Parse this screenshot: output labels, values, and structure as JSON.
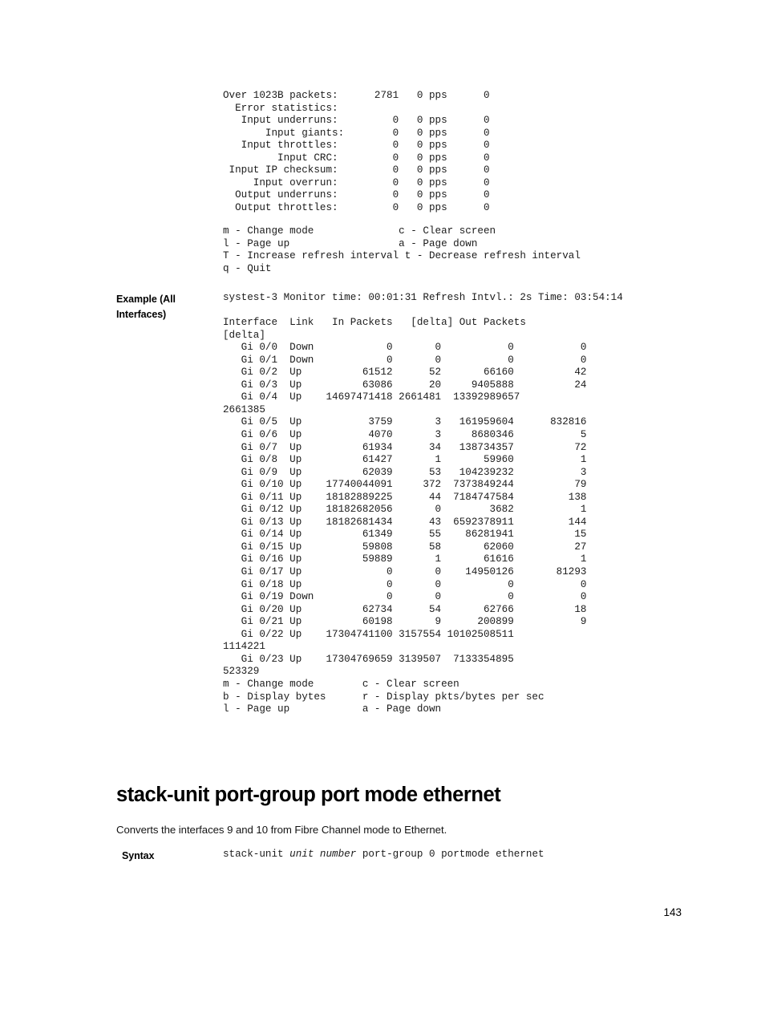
{
  "page": {
    "number": "143"
  },
  "console_stats": {
    "lines": [
      "Over 1023B packets:      2781   0 pps      0",
      "  Error statistics:",
      "   Input underruns:         0   0 pps      0",
      "       Input giants:        0   0 pps      0",
      "   Input throttles:         0   0 pps      0",
      "         Input CRC:         0   0 pps      0",
      " Input IP checksum:         0   0 pps      0",
      "     Input overrun:         0   0 pps      0",
      "  Output underruns:         0   0 pps      0",
      "  Output throttles:         0   0 pps      0"
    ]
  },
  "console_menu_first": {
    "lines": [
      "m - Change mode              c - Clear screen",
      "l - Page up                  a - Page down",
      "T - Increase refresh interval t - Decrease refresh interval",
      "q - Quit"
    ]
  },
  "example_section": {
    "label": "Example (All Interfaces)",
    "header_line": "systest-3 Monitor time: 00:01:31 Refresh Intvl.: 2s Time: 03:54:14",
    "table_header": "Interface  Link   In Packets   [delta] Out Packets [delta]",
    "columns": [
      "Interface",
      "Link",
      "In Packets",
      "[delta]",
      "Out Packets",
      "[delta]"
    ],
    "rows": [
      {
        "interface": "Gi 0/0",
        "link": "Down",
        "in_packets": "0",
        "in_delta": "0",
        "out_packets": "0",
        "out_delta": "0"
      },
      {
        "interface": "Gi 0/1",
        "link": "Down",
        "in_packets": "0",
        "in_delta": "0",
        "out_packets": "0",
        "out_delta": "0"
      },
      {
        "interface": "Gi 0/2",
        "link": "Up",
        "in_packets": "61512",
        "in_delta": "52",
        "out_packets": "66160",
        "out_delta": "42"
      },
      {
        "interface": "Gi 0/3",
        "link": "Up",
        "in_packets": "63086",
        "in_delta": "20",
        "out_packets": "9405888",
        "out_delta": "24"
      },
      {
        "interface": "Gi 0/4",
        "link": "Up",
        "in_packets": "14697471418",
        "in_delta": "2661481",
        "out_packets": "13392989657",
        "out_delta": "2661385"
      },
      {
        "interface": "Gi 0/5",
        "link": "Up",
        "in_packets": "3759",
        "in_delta": "3",
        "out_packets": "161959604",
        "out_delta": "832816"
      },
      {
        "interface": "Gi 0/6",
        "link": "Up",
        "in_packets": "4070",
        "in_delta": "3",
        "out_packets": "8680346",
        "out_delta": "5"
      },
      {
        "interface": "Gi 0/7",
        "link": "Up",
        "in_packets": "61934",
        "in_delta": "34",
        "out_packets": "138734357",
        "out_delta": "72"
      },
      {
        "interface": "Gi 0/8",
        "link": "Up",
        "in_packets": "61427",
        "in_delta": "1",
        "out_packets": "59960",
        "out_delta": "1"
      },
      {
        "interface": "Gi 0/9",
        "link": "Up",
        "in_packets": "62039",
        "in_delta": "53",
        "out_packets": "104239232",
        "out_delta": "3"
      },
      {
        "interface": "Gi 0/10",
        "link": "Up",
        "in_packets": "17740044091",
        "in_delta": "372",
        "out_packets": "7373849244",
        "out_delta": "79"
      },
      {
        "interface": "Gi 0/11",
        "link": "Up",
        "in_packets": "18182889225",
        "in_delta": "44",
        "out_packets": "7184747584",
        "out_delta": "138"
      },
      {
        "interface": "Gi 0/12",
        "link": "Up",
        "in_packets": "18182682056",
        "in_delta": "0",
        "out_packets": "3682",
        "out_delta": "1"
      },
      {
        "interface": "Gi 0/13",
        "link": "Up",
        "in_packets": "18182681434",
        "in_delta": "43",
        "out_packets": "6592378911",
        "out_delta": "144"
      },
      {
        "interface": "Gi 0/14",
        "link": "Up",
        "in_packets": "61349",
        "in_delta": "55",
        "out_packets": "86281941",
        "out_delta": "15"
      },
      {
        "interface": "Gi 0/15",
        "link": "Up",
        "in_packets": "59808",
        "in_delta": "58",
        "out_packets": "62060",
        "out_delta": "27"
      },
      {
        "interface": "Gi 0/16",
        "link": "Up",
        "in_packets": "59889",
        "in_delta": "1",
        "out_packets": "61616",
        "out_delta": "1"
      },
      {
        "interface": "Gi 0/17",
        "link": "Up",
        "in_packets": "0",
        "in_delta": "0",
        "out_packets": "14950126",
        "out_delta": "81293"
      },
      {
        "interface": "Gi 0/18",
        "link": "Up",
        "in_packets": "0",
        "in_delta": "0",
        "out_packets": "0",
        "out_delta": "0"
      },
      {
        "interface": "Gi 0/19",
        "link": "Down",
        "in_packets": "0",
        "in_delta": "0",
        "out_packets": "0",
        "out_delta": "0"
      },
      {
        "interface": "Gi 0/20",
        "link": "Up",
        "in_packets": "62734",
        "in_delta": "54",
        "out_packets": "62766",
        "out_delta": "18"
      },
      {
        "interface": "Gi 0/21",
        "link": "Up",
        "in_packets": "60198",
        "in_delta": "9",
        "out_packets": "200899",
        "out_delta": "9"
      },
      {
        "interface": "Gi 0/22",
        "link": "Up",
        "in_packets": "17304741100",
        "in_delta": "3157554",
        "out_packets": "10102508511",
        "out_delta": "1114221"
      },
      {
        "interface": "Gi 0/23",
        "link": "Up",
        "in_packets": "17304769659",
        "in_delta": "3139507",
        "out_packets": "7133354895",
        "out_delta": "523329"
      }
    ],
    "rendered_lines": [
      "Interface  Link   In Packets   [delta] Out Packets",
      "[delta]",
      "   Gi 0/0  Down            0       0           0           0",
      "   Gi 0/1  Down            0       0           0           0",
      "   Gi 0/2  Up          61512      52       66160          42",
      "   Gi 0/3  Up          63086      20     9405888          24",
      "   Gi 0/4  Up    14697471418 2661481  13392989657",
      "2661385",
      "   Gi 0/5  Up           3759       3   161959604      832816",
      "   Gi 0/6  Up           4070       3     8680346           5",
      "   Gi 0/7  Up          61934      34   138734357          72",
      "   Gi 0/8  Up          61427       1       59960           1",
      "   Gi 0/9  Up          62039      53   104239232           3",
      "   Gi 0/10 Up    17740044091     372  7373849244          79",
      "   Gi 0/11 Up    18182889225      44  7184747584         138",
      "   Gi 0/12 Up    18182682056       0        3682           1",
      "   Gi 0/13 Up    18182681434      43  6592378911         144",
      "   Gi 0/14 Up          61349      55    86281941          15",
      "   Gi 0/15 Up          59808      58       62060          27",
      "   Gi 0/16 Up          59889       1       61616           1",
      "   Gi 0/17 Up              0       0    14950126       81293",
      "   Gi 0/18 Up              0       0           0           0",
      "   Gi 0/19 Down            0       0           0           0",
      "   Gi 0/20 Up          62734      54       62766          18",
      "   Gi 0/21 Up          60198       9      200899           9",
      "   Gi 0/22 Up    17304741100 3157554 10102508511",
      "1114221",
      "   Gi 0/23 Up    17304769659 3139507  7133354895",
      "523329"
    ],
    "footer_menu": [
      "m - Change mode        c - Clear screen",
      "b - Display bytes      r - Display pkts/bytes per sec",
      "l - Page up            a - Page down"
    ]
  },
  "command_section": {
    "heading": "stack-unit port-group port mode ethernet",
    "description": "Converts the interfaces 9 and 10 from Fibre Channel mode to Ethernet.",
    "syntax_label": "Syntax",
    "syntax_parts": [
      {
        "text": "stack-unit ",
        "italic": false
      },
      {
        "text": "unit number",
        "italic": true
      },
      {
        "text": " port-group 0 portmode ethernet",
        "italic": false
      }
    ],
    "syntax_plain": "stack-unit unit number port-group 0 portmode ethernet"
  }
}
